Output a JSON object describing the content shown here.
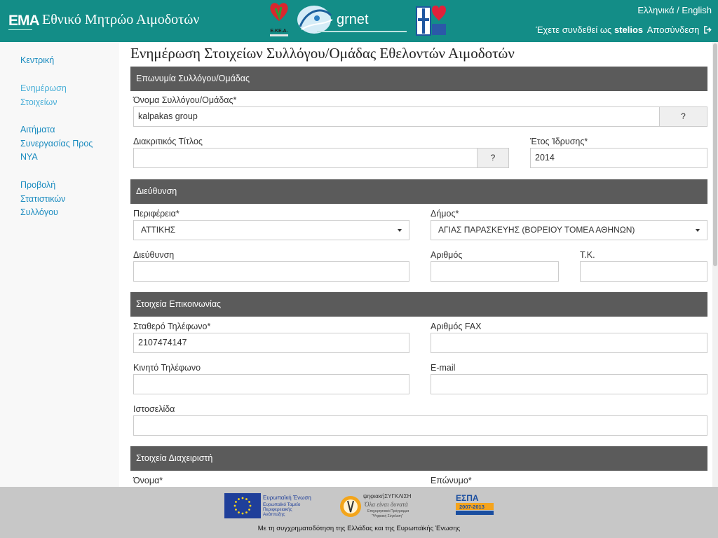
{
  "header": {
    "logo_text": "EMA",
    "site_title": "Εθνικό Μητρώο Αιμοδοτών",
    "partner_logos": [
      {
        "name": "ekea-logo",
        "text": "Ε.ΚΕ.Α."
      },
      {
        "name": "grnet-logo",
        "text": "grnet"
      },
      {
        "name": "ministry-health-logo",
        "text": ""
      }
    ],
    "lang": {
      "greek": "Ελληνικά",
      "sep": "/",
      "english": "English"
    },
    "user": {
      "prefix": "Έχετε συνδεθεί ως",
      "username": "stelios",
      "logout": "Αποσύνδεση"
    }
  },
  "sidebar": {
    "items": [
      {
        "lines": [
          "Κεντρική"
        ],
        "active": false
      },
      {
        "lines": [
          "Ενημέρωση",
          "Στοιχείων"
        ],
        "active": true
      },
      {
        "lines": [
          "Αιτήματα",
          "Συνεργασίας Προς",
          "ΝΥΑ"
        ],
        "active": false
      },
      {
        "lines": [
          "Προβολή",
          "Στατιστικών",
          "Συλλόγου"
        ],
        "active": false
      }
    ]
  },
  "main": {
    "page_title": "Ενημέρωση Στοιχείων Συλλόγου/Ομάδας Εθελοντών Αιμοδοτών",
    "sections": {
      "name": "Επωνυμία Συλλόγου/Ομάδας",
      "address": "Διεύθυνση",
      "contact": "Στοιχεία Επικοινωνίας",
      "admin": "Στοιχεία Διαχειριστή"
    },
    "help_label": "?",
    "fields": {
      "group_name": {
        "label": "Όνομα Συλλόγου/Ομάδας*",
        "value": "kalpakas group"
      },
      "distinctive_title": {
        "label": "Διακριτικός Τίτλος",
        "value": ""
      },
      "founding_year": {
        "label": "Έτος Ίδρυσης*",
        "value": "2014"
      },
      "region": {
        "label": "Περιφέρεια*",
        "value": "ΑΤΤΙΚΗΣ"
      },
      "municipality": {
        "label": "Δήμος*",
        "value": "ΑΓΙΑΣ ΠΑΡΑΣΚΕΥΗΣ (ΒΟΡΕΙΟΥ ΤΟΜΕΑ ΑΘΗΝΩΝ)"
      },
      "street": {
        "label": "Διεύθυνση",
        "value": ""
      },
      "street_number": {
        "label": "Αριθμός",
        "value": ""
      },
      "postal_code": {
        "label": "Τ.Κ.",
        "value": ""
      },
      "phone": {
        "label": "Σταθερό Τηλέφωνο*",
        "value": "2107474147"
      },
      "fax": {
        "label": "Αριθμός FAX",
        "value": ""
      },
      "mobile": {
        "label": "Κινητό Τηλέφωνο",
        "value": ""
      },
      "email": {
        "label": "E-mail",
        "value": ""
      },
      "website": {
        "label": "Ιστοσελίδα",
        "value": ""
      },
      "admin_first_name": {
        "label": "Όνομα*"
      },
      "admin_last_name": {
        "label": "Επώνυμο*"
      }
    }
  },
  "footer": {
    "text": "Με τη συγχρηματοδότηση της Ελλάδας και της Ευρωπαϊκής Ένωσης",
    "logos": [
      {
        "name": "eu-flag-logo",
        "lines": [
          "Ευρωπαϊκή Ένωση",
          "Ευρωπαϊκό Ταμείο",
          "Περιφερειακής",
          "Ανάπτυξης"
        ]
      },
      {
        "name": "digital-convergence-logo",
        "lines": [
          "ψηφιακήΣΥΓΚΛΙΣΗ",
          "Όλα είναι δυνατά",
          "Επιχειρησιακό Πρόγραμμα",
          "\"Ψηφιακή Σύγκλιση\""
        ]
      },
      {
        "name": "espa-logo",
        "lines": [
          "ΕΣΠΑ",
          "2007-2013"
        ]
      }
    ]
  },
  "colors": {
    "header": "#138d87",
    "section_bar": "#5b5b5b",
    "link": "#1a8bbf",
    "footer": "#c7c7c7"
  }
}
